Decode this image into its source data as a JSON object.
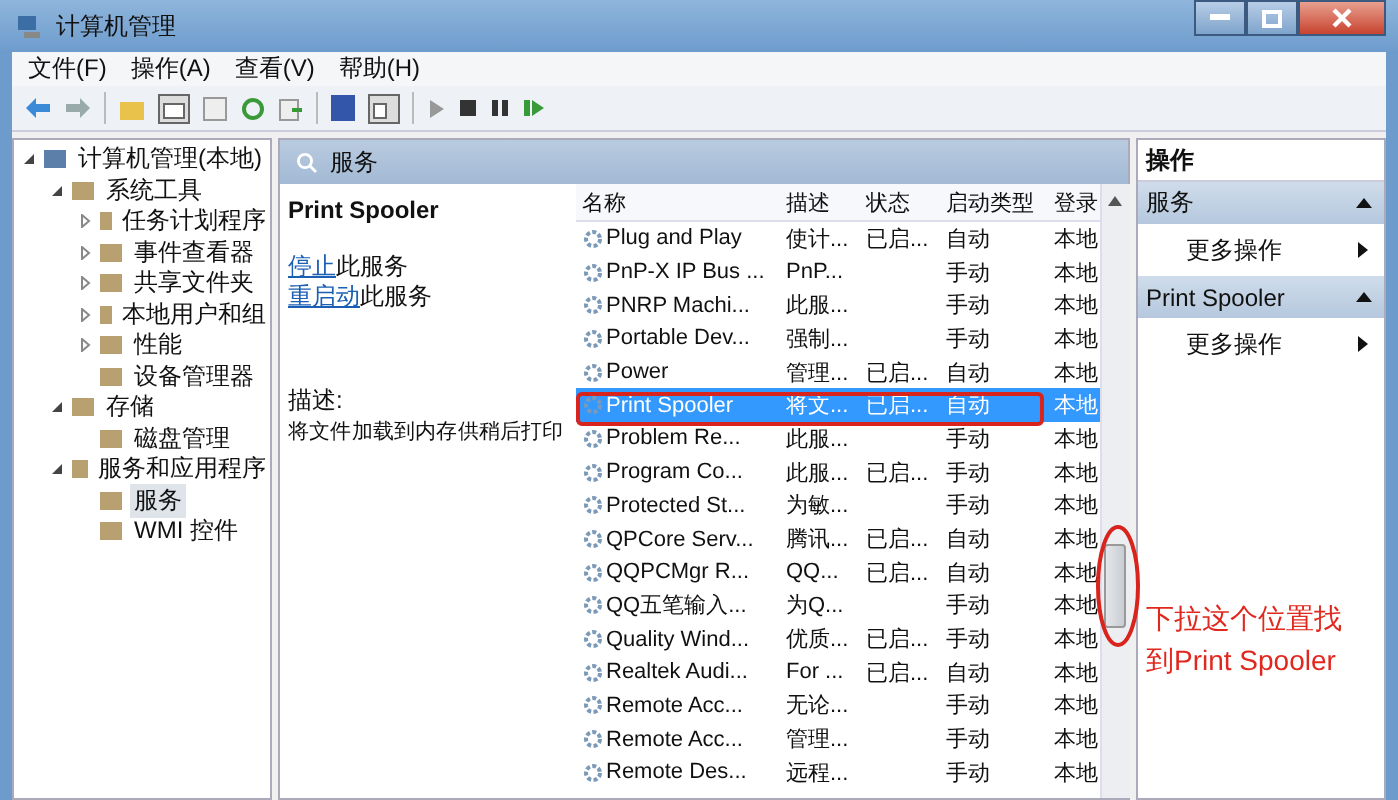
{
  "window": {
    "title": "计算机管理"
  },
  "menu": [
    "文件(F)",
    "操作(A)",
    "查看(V)",
    "帮助(H)"
  ],
  "tree": [
    {
      "label": "计算机管理(本地)",
      "expanded": true,
      "selected": false,
      "children": [
        {
          "label": "系统工具",
          "expanded": true,
          "selected": false,
          "children": [
            {
              "label": "任务计划程序",
              "expanded": false,
              "selected": false
            },
            {
              "label": "事件查看器",
              "expanded": false,
              "selected": false
            },
            {
              "label": "共享文件夹",
              "expanded": false,
              "selected": false
            },
            {
              "label": "本地用户和组",
              "expanded": false,
              "selected": false
            },
            {
              "label": "性能",
              "expanded": false,
              "selected": false
            },
            {
              "label": "设备管理器",
              "selected": false
            }
          ]
        },
        {
          "label": "存储",
          "expanded": true,
          "selected": false,
          "children": [
            {
              "label": "磁盘管理",
              "selected": false
            }
          ]
        },
        {
          "label": "服务和应用程序",
          "expanded": true,
          "selected": false,
          "children": [
            {
              "label": "服务",
              "selected": true
            },
            {
              "label": "WMI 控件",
              "selected": false
            }
          ]
        }
      ]
    }
  ],
  "services_header": "服务",
  "detail": {
    "title": "Print Spooler",
    "actions": [
      {
        "link": "停止",
        "rest": "此服务"
      },
      {
        "link": "重启动",
        "rest": "此服务"
      }
    ],
    "description_label": "描述:",
    "description": "将文件加载到内存供稍后打印"
  },
  "table": {
    "columns": [
      "名称",
      "描述",
      "状态",
      "启动类型",
      "登录"
    ],
    "rows": [
      {
        "cells": [
          "Plug and Play",
          "使计...",
          "已启...",
          "自动",
          "本地"
        ],
        "selected": false
      },
      {
        "cells": [
          "PnP-X IP Bus ...",
          "PnP...",
          "",
          "手动",
          "本地"
        ],
        "selected": false
      },
      {
        "cells": [
          "PNRP Machi...",
          "此服...",
          "",
          "手动",
          "本地"
        ],
        "selected": false
      },
      {
        "cells": [
          "Portable Dev...",
          "强制...",
          "",
          "手动",
          "本地"
        ],
        "selected": false
      },
      {
        "cells": [
          "Power",
          "管理...",
          "已启...",
          "自动",
          "本地"
        ],
        "selected": false
      },
      {
        "cells": [
          "Print Spooler",
          "将文...",
          "已启...",
          "自动",
          "本地"
        ],
        "selected": true
      },
      {
        "cells": [
          "Problem Re...",
          "此服...",
          "",
          "手动",
          "本地"
        ],
        "selected": false
      },
      {
        "cells": [
          "Program Co...",
          "此服...",
          "已启...",
          "手动",
          "本地"
        ],
        "selected": false
      },
      {
        "cells": [
          "Protected St...",
          "为敏...",
          "",
          "手动",
          "本地"
        ],
        "selected": false
      },
      {
        "cells": [
          "QPCore Serv...",
          "腾讯...",
          "已启...",
          "自动",
          "本地"
        ],
        "selected": false
      },
      {
        "cells": [
          "QQPCMgr R...",
          "QQ...",
          "已启...",
          "自动",
          "本地"
        ],
        "selected": false
      },
      {
        "cells": [
          "QQ五笔输入...",
          "为Q...",
          "",
          "手动",
          "本地"
        ],
        "selected": false
      },
      {
        "cells": [
          "Quality Wind...",
          "优质...",
          "已启...",
          "手动",
          "本地"
        ],
        "selected": false
      },
      {
        "cells": [
          "Realtek Audi...",
          "For ...",
          "已启...",
          "自动",
          "本地"
        ],
        "selected": false
      },
      {
        "cells": [
          "Remote Acc...",
          "无论...",
          "",
          "手动",
          "本地"
        ],
        "selected": false
      },
      {
        "cells": [
          "Remote Acc...",
          "管理...",
          "",
          "手动",
          "本地"
        ],
        "selected": false
      },
      {
        "cells": [
          "Remote Des...",
          "远程...",
          "",
          "手动",
          "本地"
        ],
        "selected": false
      }
    ]
  },
  "actions_panel": {
    "title": "操作",
    "sections": [
      {
        "title": "服务",
        "item": "更多操作"
      },
      {
        "title": "Print Spooler",
        "item": "更多操作"
      }
    ]
  },
  "annotation": {
    "lines": [
      "下拉这个位置找",
      "到Print Spooler"
    ]
  }
}
